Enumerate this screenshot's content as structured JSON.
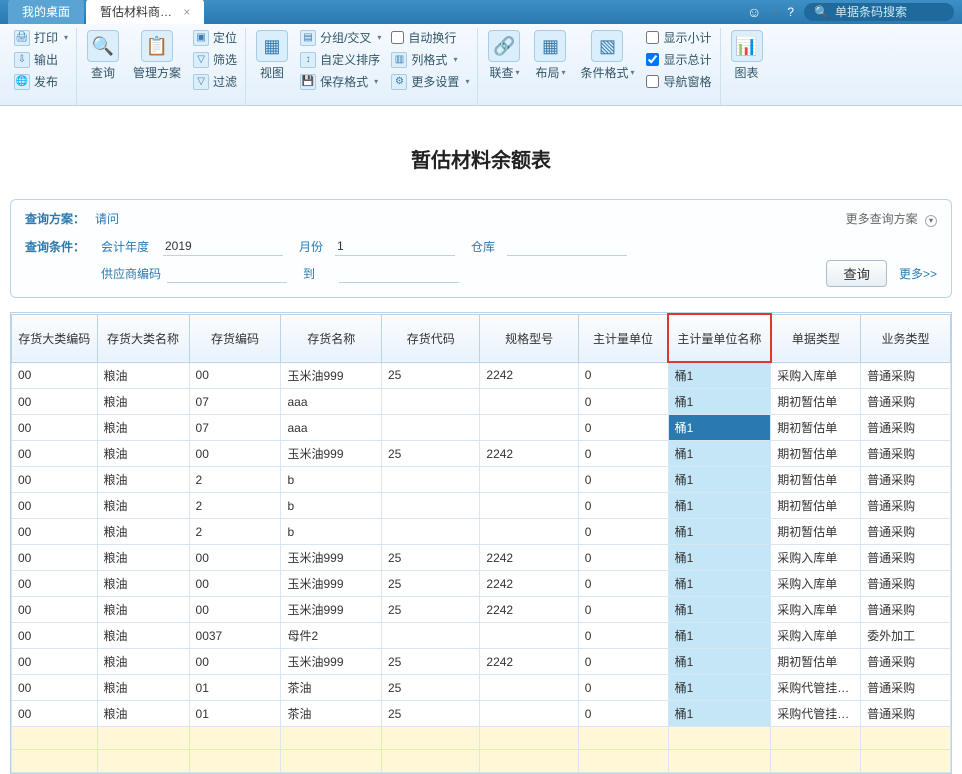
{
  "topbar": {
    "tab_desktop": "我的桌面",
    "tab_active": "暂估材料商…",
    "search_placeholder": "单据条码搜索"
  },
  "ribbon": {
    "print": "打印",
    "export": "输出",
    "publish": "发布",
    "query": "查询",
    "manage_scheme": "管理方案",
    "locate": "定位",
    "filter": "筛选",
    "filter2": "过滤",
    "view": "视图",
    "group_cross": "分组/交叉",
    "custom_sort": "自定义排序",
    "save_format": "保存格式",
    "auto_wrap": "自动换行",
    "col_format": "列格式",
    "more_settings": "更多设置",
    "related": "联查",
    "layout": "布局",
    "cond_format": "条件格式",
    "show_subtotal": "显示小计",
    "show_total": "显示总计",
    "nav_pane": "导航窗格",
    "chart": "图表"
  },
  "page": {
    "title": "暂估材料余额表",
    "scheme_label": "查询方案：",
    "scheme_value": "请问",
    "more_scheme": "更多查询方案",
    "cond_label": "查询条件：",
    "year_label": "会计年度",
    "year_value": "2019",
    "month_label": "月份",
    "month_value": "1",
    "warehouse_label": "仓库",
    "warehouse_value": "",
    "supplier_label": "供应商编码",
    "supplier_value": "",
    "to_label": "到",
    "to_value": "",
    "query_btn": "查询",
    "more_link": "更多>>"
  },
  "columns": [
    "存货大类编码",
    "存货大类名称",
    "存货编码",
    "存货名称",
    "存货代码",
    "规格型号",
    "主计量单位",
    "主计量单位名称",
    "单据类型",
    "业务类型"
  ],
  "rows": [
    [
      "00",
      "粮油",
      "00",
      "玉米油999",
      "25",
      "2242",
      "0",
      "桶1",
      "采购入库单",
      "普通采购"
    ],
    [
      "00",
      "粮油",
      "07",
      "aaa",
      "",
      "",
      "0",
      "桶1",
      "期初暂估单",
      "普通采购"
    ],
    [
      "00",
      "粮油",
      "07",
      "aaa",
      "",
      "",
      "0",
      "桶1",
      "期初暂估单",
      "普通采购"
    ],
    [
      "00",
      "粮油",
      "00",
      "玉米油999",
      "25",
      "2242",
      "0",
      "桶1",
      "期初暂估单",
      "普通采购"
    ],
    [
      "00",
      "粮油",
      "2",
      "b",
      "",
      "",
      "0",
      "桶1",
      "期初暂估单",
      "普通采购"
    ],
    [
      "00",
      "粮油",
      "2",
      "b",
      "",
      "",
      "0",
      "桶1",
      "期初暂估单",
      "普通采购"
    ],
    [
      "00",
      "粮油",
      "2",
      "b",
      "",
      "",
      "0",
      "桶1",
      "期初暂估单",
      "普通采购"
    ],
    [
      "00",
      "粮油",
      "00",
      "玉米油999",
      "25",
      "2242",
      "0",
      "桶1",
      "采购入库单",
      "普通采购"
    ],
    [
      "00",
      "粮油",
      "00",
      "玉米油999",
      "25",
      "2242",
      "0",
      "桶1",
      "采购入库单",
      "普通采购"
    ],
    [
      "00",
      "粮油",
      "00",
      "玉米油999",
      "25",
      "2242",
      "0",
      "桶1",
      "采购入库单",
      "普通采购"
    ],
    [
      "00",
      "粮油",
      "0037",
      "母件2",
      "",
      "",
      "0",
      "桶1",
      "采购入库单",
      "委外加工"
    ],
    [
      "00",
      "粮油",
      "00",
      "玉米油999",
      "25",
      "2242",
      "0",
      "桶1",
      "期初暂估单",
      "普通采购"
    ],
    [
      "00",
      "粮油",
      "01",
      "茶油",
      "25",
      "",
      "0",
      "桶1",
      "采购代管挂…",
      "普通采购"
    ],
    [
      "00",
      "粮油",
      "01",
      "茶油",
      "25",
      "",
      "0",
      "桶1",
      "采购代管挂…",
      "普通采购"
    ]
  ],
  "selected_row": 2,
  "accent_border": "#d93a2b"
}
